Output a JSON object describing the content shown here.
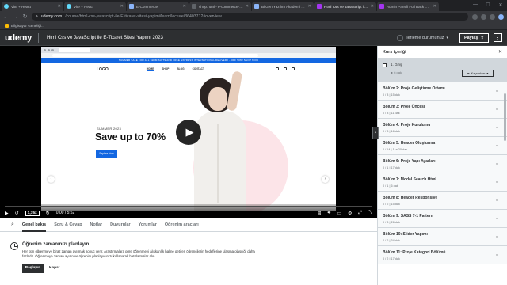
{
  "browser": {
    "tabs": [
      {
        "label": "Vite + React",
        "icon": "react-icon"
      },
      {
        "label": "Vite + React",
        "icon": "react-icon"
      },
      {
        "label": "E-Commerce",
        "icon": "page-icon"
      },
      {
        "label": "shop.html - e-commerce-udemy",
        "icon": "page-icon"
      },
      {
        "label": "BilGen Yazılım Akademi | Bilgisayar",
        "icon": "page-icon"
      },
      {
        "label": "Html Css ve JavaScript ile E-Ticaret",
        "icon": "udemy-icon",
        "active": true
      },
      {
        "label": "Admin Paneli Full Back React İle",
        "icon": "udemy-icon"
      }
    ],
    "url_host": "udemy.com",
    "url_path": "/course/html-css-javascript-ile-E-ticaret-sitesi-yapimi/learn/lecture/36403712#overview",
    "bookmark": "Bilgisayar Geneliği..."
  },
  "header": {
    "logo": "udemy",
    "course_title": "Html Css ve JavaScript ile E-Ticaret Sitesi Yapımı 2023",
    "progress_label": "İlerleme durumunuz",
    "share_label": "Paylaş",
    "more_label": "⋮"
  },
  "video": {
    "slide": {
      "promo": "SUMMER SALE FOR ALL SWIM SUITS AND FREE EXPRESS INTERNATIONAL DELIVERY - OFF 50%!  SHOP NOW",
      "logo": "LOGO",
      "menu": [
        "HOME",
        "SHOP",
        "BLOG",
        "CONTACT"
      ],
      "small": "SUMMER 2023",
      "headline": "Save up to 70%",
      "button": "Explore Now"
    },
    "speed": "1,75x",
    "time": "0:00 / 5:52",
    "progress": 0.0
  },
  "tabs": {
    "items": [
      "Genel bakış",
      "Soru & Cevap",
      "Notlar",
      "Duyurular",
      "Yorumlar",
      "Öğrenim araçları"
    ],
    "active": 0
  },
  "schedule": {
    "title": "Öğrenim zamanınızı planlayın",
    "text": "Her gün öğrenmeye biraz zaman ayırmak sonuç verir. Araştırmalara göre öğrenmeyi alışkanlık haline getiren öğrencilerin hedeflerine ulaşma olasılığı daha fazladır. Öğrenmeye zaman ayırın ve öğrenim planlayıcınızı kullanarak hatırlatmalar alın.",
    "start_label": "Başlayın",
    "close_label": "Kapat"
  },
  "sidebar": {
    "title": "Kurs içeriği",
    "close": "✕",
    "current_lesson": {
      "title": "1. Giriş",
      "duration": "6 dak",
      "resources_label": "Kaynaklar"
    },
    "sections": [
      {
        "title": "Bölüm 2: Proje Geliştirme Ortamı",
        "meta": "0 / 3 | 15 dak"
      },
      {
        "title": "Bölüm 3: Proje Öncesi",
        "meta": "0 / 3 | 11 dak"
      },
      {
        "title": "Bölüm 4: Proje Kurulumu",
        "meta": "0 / 3 | 16 dak"
      },
      {
        "title": "Bölüm 5: Header Oluşturma",
        "meta": "0 / 14 | 1sa 20 dak"
      },
      {
        "title": "Bölüm 6: Proje Yapı Ayarları",
        "meta": "0 / 1 | 17 dak"
      },
      {
        "title": "Bölüm 7: Modal Search Html",
        "meta": "0 / 1 | 6 dak"
      },
      {
        "title": "Bölüm 8: Header Responsive",
        "meta": "0 / 2 | 15 dak"
      },
      {
        "title": "Bölüm 9: SASS 7-1 Pattern",
        "meta": "0 / 3 | 26 dak"
      },
      {
        "title": "Bölüm 10: Slider Yapımı",
        "meta": "0 / 2 | 34 dak"
      },
      {
        "title": "Bölüm 11: Proje Kategori Bölümü",
        "meta": "0 / 2 | 17 dak"
      }
    ]
  },
  "colors": {
    "accent": "#a435f0",
    "dark": "#2d2f31",
    "slide_blue": "#1367e1"
  }
}
